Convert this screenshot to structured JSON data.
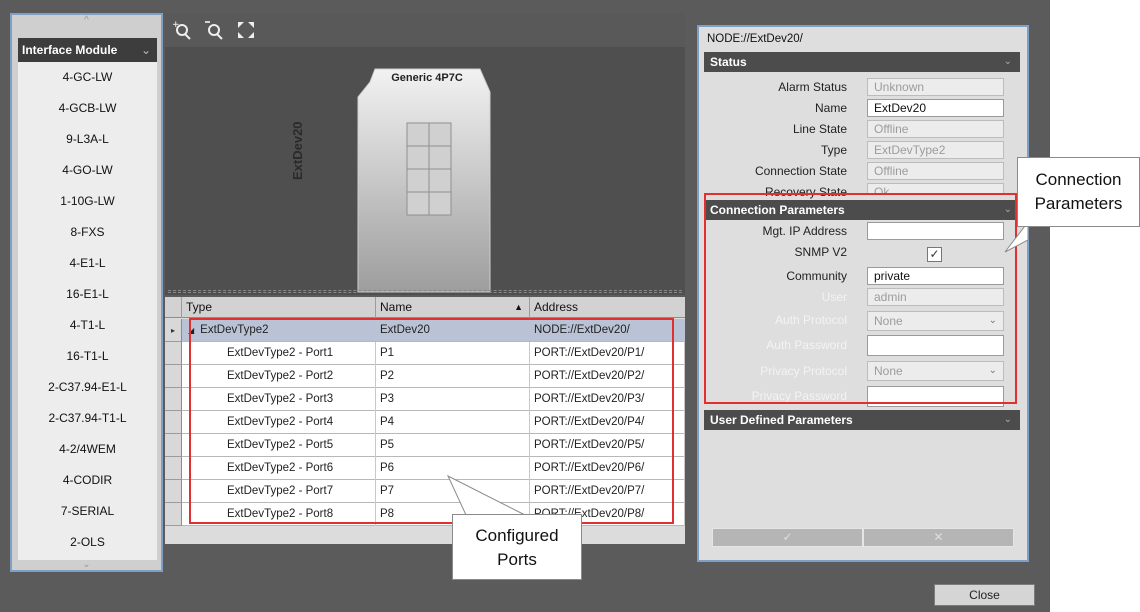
{
  "left_panel": {
    "header": "Interface Module",
    "items": [
      "4-GC-LW",
      "4-GCB-LW",
      "9-L3A-L",
      "4-GO-LW",
      "1-10G-LW",
      "8-FXS",
      "4-E1-L",
      "16-E1-L",
      "4-T1-L",
      "16-T1-L",
      "2-C37.94-E1-L",
      "2-C37.94-T1-L",
      "4-2/4WEM",
      "4-CODIR",
      "7-SERIAL",
      "2-OLS"
    ]
  },
  "toolbar": {
    "icons": [
      "zoom-in-icon",
      "zoom-out-icon",
      "fit-to-screen-icon"
    ]
  },
  "device": {
    "model": "Generic 4P7C",
    "name": "ExtDev20"
  },
  "table": {
    "columns": [
      "Type",
      "Name",
      "Address"
    ],
    "parent": {
      "type": "ExtDevType2",
      "name": "ExtDev20",
      "address": "NODE://ExtDev20/"
    },
    "rows": [
      {
        "type": "ExtDevType2 - Port1",
        "name": "P1",
        "address": "PORT://ExtDev20/P1/"
      },
      {
        "type": "ExtDevType2 - Port2",
        "name": "P2",
        "address": "PORT://ExtDev20/P2/"
      },
      {
        "type": "ExtDevType2 - Port3",
        "name": "P3",
        "address": "PORT://ExtDev20/P3/"
      },
      {
        "type": "ExtDevType2 - Port4",
        "name": "P4",
        "address": "PORT://ExtDev20/P4/"
      },
      {
        "type": "ExtDevType2 - Port5",
        "name": "P5",
        "address": "PORT://ExtDev20/P5/"
      },
      {
        "type": "ExtDevType2 - Port6",
        "name": "P6",
        "address": "PORT://ExtDev20/P6/"
      },
      {
        "type": "ExtDevType2 - Port7",
        "name": "P7",
        "address": "PORT://ExtDev20/P7/"
      },
      {
        "type": "ExtDevType2 - Port8",
        "name": "P8",
        "address": "PORT://ExtDev20/P8/"
      }
    ]
  },
  "right_panel": {
    "node_path": "NODE://ExtDev20/",
    "status": {
      "title": "Status",
      "fields": [
        {
          "label": "Alarm Status",
          "value": "Unknown"
        },
        {
          "label": "Name",
          "value": "ExtDev20"
        },
        {
          "label": "Line State",
          "value": "Offline"
        },
        {
          "label": "Type",
          "value": "ExtDevType2"
        },
        {
          "label": "Connection State",
          "value": "Offline"
        },
        {
          "label": "Recovery State",
          "value": "Ok"
        }
      ]
    },
    "connection": {
      "title": "Connection Parameters",
      "mgt_ip_label": "Mgt. IP Address",
      "mgt_ip_value": "",
      "snmp_label": "SNMP V2",
      "snmp_checked": "✓",
      "community_label": "Community",
      "community_value": "private",
      "user_label": "User",
      "user_value": "admin",
      "auth_protocol_label": "Auth Protocol",
      "auth_protocol_value": "None",
      "auth_password_label": "Auth Password",
      "auth_password_value": "",
      "privacy_protocol_label": "Privacy Protocol",
      "privacy_protocol_value": "None",
      "privacy_password_label": "Privacy Password",
      "privacy_password_value": ""
    },
    "user_defined": {
      "title": "User Defined Parameters"
    },
    "apply_label": "✓",
    "cancel_label": "✕"
  },
  "close_label": "Close",
  "annotations": {
    "connection": "Connection Parameters",
    "ports": "Configured Ports"
  },
  "colors": {
    "annotation_border": "#e03030",
    "selected_row": "#b9c3d5",
    "frame": "#7ea0c4"
  }
}
